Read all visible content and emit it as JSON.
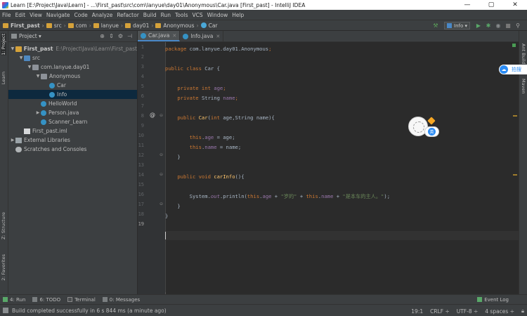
{
  "window": {
    "title": "Learn [E:\\Project\\Java\\Learn] - ...\\First_past\\src\\com\\lanyue\\day01\\Anonymous\\Car.java [First_past] - IntelliJ IDEA",
    "minimize": "—",
    "maximize": "▢",
    "close": "✕"
  },
  "menu": [
    "File",
    "Edit",
    "View",
    "Navigate",
    "Code",
    "Analyze",
    "Refactor",
    "Build",
    "Run",
    "Tools",
    "VCS",
    "Window",
    "Help"
  ],
  "breadcrumb": [
    "First_past",
    "src",
    "com",
    "lanyue",
    "day01",
    "Anonymous",
    "Car"
  ],
  "run_config": "Info",
  "sidebar_left": {
    "project": "1: Project",
    "learn": "Learn",
    "structure": "Z: Structure",
    "favorites": "2: Favorites"
  },
  "sidebar_right": {
    "ant": "Ant Build",
    "maven": "Maven"
  },
  "project_panel": {
    "title": "Project",
    "tree": [
      {
        "label": "First_past",
        "path": "E:\\Project\\Java\\Learn\\First_past"
      },
      {
        "label": "src"
      },
      {
        "label": "com.lanyue.day01"
      },
      {
        "label": "Anonymous"
      },
      {
        "label": "Car"
      },
      {
        "label": "Info"
      },
      {
        "label": "HelloWorld"
      },
      {
        "label": "Person.java"
      },
      {
        "label": "Scanner_Learn"
      },
      {
        "label": "First_past.iml"
      },
      {
        "label": "External Libraries"
      },
      {
        "label": "Scratches and Consoles"
      }
    ]
  },
  "tabs": [
    {
      "label": "Car.java"
    },
    {
      "label": "Info.java"
    }
  ],
  "line_numbers": [
    "1",
    "2",
    "3",
    "4",
    "5",
    "6",
    "7",
    "8",
    "9",
    "10",
    "11",
    "12",
    "13",
    "14",
    "15",
    "16",
    "17",
    "18",
    "19"
  ],
  "code": {
    "l1a": "package ",
    "l1b": "com.lanyue.day01.Anonymous",
    "l1c": ";",
    "l3a": "public class ",
    "l3b": "Car {",
    "l5a": "private int ",
    "l5b": "age",
    "l5c": ";",
    "l6a": "private ",
    "l6b": "String ",
    "l6c": "name",
    "l6d": ";",
    "l8a": "public ",
    "l8b": "Car",
    "l8c": "(",
    "l8d": "int ",
    "l8e": "age,String name){",
    "l10a": "this",
    "l10b": ".",
    "l10c": "age",
    "l10d": " = age;",
    "l11a": "this",
    "l11b": ".",
    "l11c": "name",
    "l11d": " = name;",
    "l12": "}",
    "l14a": "public void ",
    "l14b": "carInfo",
    "l14c": "(){",
    "l16a": "System.",
    "l16b": "out",
    "l16c": ".println(",
    "l16d": "this",
    "l16e": ".",
    "l16f": "age",
    "l16g": " + ",
    "l16h": "\"岁的\"",
    "l16i": " + ",
    "l16j": "this",
    "l16k": ".",
    "l16l": "name",
    "l16m": " + ",
    "l16n": "\"是本车的主人。\"",
    "l16o": ");",
    "l17": "}",
    "l18": "}"
  },
  "assistant_badge": "英",
  "cloud_button": "拍搜",
  "bottom_tabs": {
    "run": "4: Run",
    "todo": "6: TODO",
    "terminal": "Terminal",
    "messages": "0: Messages",
    "event_log": "Event Log"
  },
  "status": {
    "message": "Build completed successfully in 6 s 844 ms (a minute ago)",
    "position": "19:1",
    "line_sep": "CRLF ÷",
    "encoding": "UTF-8 ÷",
    "indent": "4 spaces ÷"
  }
}
